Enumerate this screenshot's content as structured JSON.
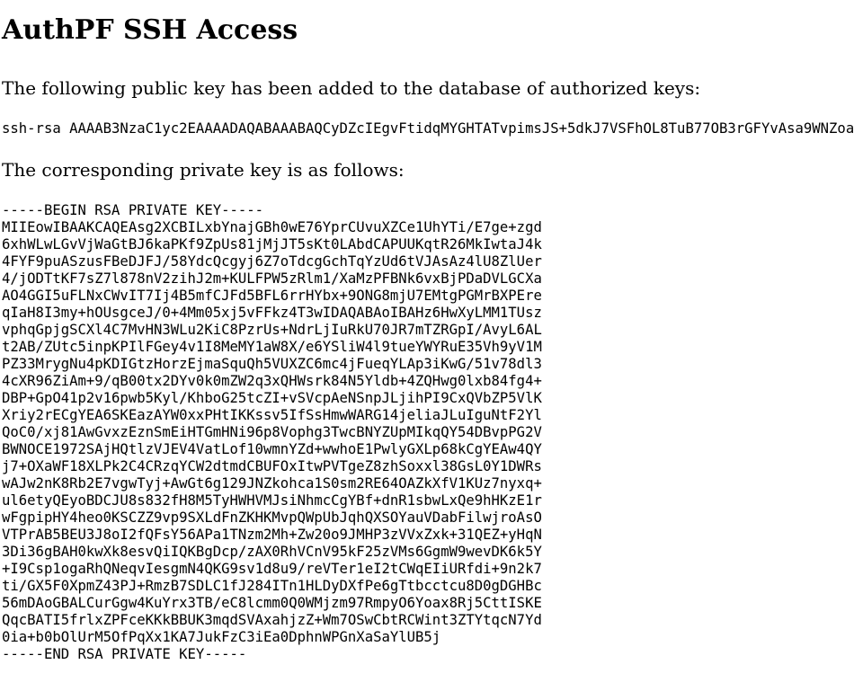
{
  "page": {
    "title": "AuthPF SSH Access",
    "public_key_intro": "The following public key has been added to the database of authorized keys:",
    "public_key": "ssh-rsa AAAAB3NzaC1yc2EAAAADAQABAAABAQCyDZcIEgvFtidqMYGHTATvpimsJS+5dkJ7VSFhOL8TuB77OB3rGFYvAsa9WNZoa",
    "private_key_intro": "The corresponding private key is as follows:",
    "private_key": "-----BEGIN RSA PRIVATE KEY-----\nMIIEowIBAAKCAQEAsg2XCBILxbYnajGBh0wE76YprCUvuXZCe1UhYTi/E7ge+zgd\n6xhWLwLGvVjWaGtBJ6kaPKf9ZpUs81jMjJT5sKt0LAbdCAPUUKqtR26MkIwtaJ4k\n4FYF9puASzusFBeDJFJ/58YdcQcgyj6Z7oTdcgGchTqYzUd6tVJAsAz4lU8ZlUer\n4/jODTtKF7sZ7l878nV2zihJ2m+KULFPW5zRlm1/XaMzPFBNk6vxBjPDaDVLGCXa\nAO4GGI5uFLNxCWvIT7Ij4B5mfCJFd5BFL6rrHYbx+9ONG8mjU7EMtgPGMrBXPEre\nqIaH8I3my+hOUsgceJ/0+4Mm05xj5vFFkz4T3wIDAQABAoIBAHz6HwXyLMM1TUsz\nvphqGpjgSCXl4C7MvHN3WLu2KiC8PzrUs+NdrLjIuRkU70JR7mTZRGpI/AvyL6AL\nt2AB/ZUtc5inpKPIlFGey4v1I8MeMY1aW8X/e6YSliW4l9tueYWYRuE35Vh9yV1M\nPZ33MrygNu4pKDIGtzHorzEjmaSquQh5VUXZC6mc4jFueqYLAp3iKwG/51v78dl3\n4cXR96ZiAm+9/qB00tx2DYv0k0mZW2q3xQHWsrk84N5Yldb+4ZQHwg0lxb84fg4+\nDBP+GpO41p2v16pwb5Kyl/KhboG25tcZI+vSVcpAeNSnpJLjihPI9CxQVbZP5VlK\nXriy2rECgYEA6SKEazAYW0xxPHtIKKssv5IfSsHmwWARG14jeliaJLuIguNtF2Yl\nQoC0/xj81AwGvxzEznSmEiHTGmHNi96p8Vophg3TwcBNYZUpMIkqQY54DBvpPG2V\nBWNOCE1972SAjHQtlzVJEV4VatLof10wmnYZd+wwhoE1PwlyGXLp68kCgYEAw4QY\nj7+OXaWF18XLPk2C4CRzqYCW2dtmdCBUFOxItwPVTgeZ8zhSoxxl38GsL0Y1DWRs\nwAJw2nK8Rb2E7vgwTyj+AwGt6g129JNZkohca1S0sm2RE64OAZkXfV1KUz7nyxq+\nul6etyQEyoBDCJU8s832fH8M5TyHWHVMJsiNhmcCgYBf+dnR1sbwLxQe9hHKzE1r\nwFgpipHY4heo0KSCZZ9vp9SXLdFnZKHKMvpQWpUbJqhQXSOYauVDabFilwjroAsO\nVTPrAB5BEU3J8oI2fQFsY56APa1TNzm2Mh+Zw20o9JMHP3zVVxZxk+31QEZ+yHqN\n3Di36gBAH0kwXk8esvQiIQKBgDcp/zAX0RhVCnV95kF25zVMs6GgmW9wevDK6k5Y\n+I9Csp1ogaRhQNeqvIesgmN4QKG9sv1d8u9/reVTer1eI2tCWqEIiURfdi+9n2k7\nti/GX5F0XpmZ43PJ+RmzB7SDLC1fJ284ITn1HLDyDXfPe6gTtbcctcu8D0gDGHBc\n56mDAoGBALCurGgw4KuYrx3TB/eC8lcmm0Q0WMjzm97RmpyO6Yoax8Rj5CttISKE\nQqcBATI5frlxZPFceKKkBBUK3mqdSVAxahjzZ+Wm7OSwCbtRCWint3ZTYtqcN7Yd\n0ia+b0bOlUrM5OfPqXx1KA7JukFzC3iEa0DphnWPGnXaSaYlUB5j\n-----END RSA PRIVATE KEY-----"
  }
}
